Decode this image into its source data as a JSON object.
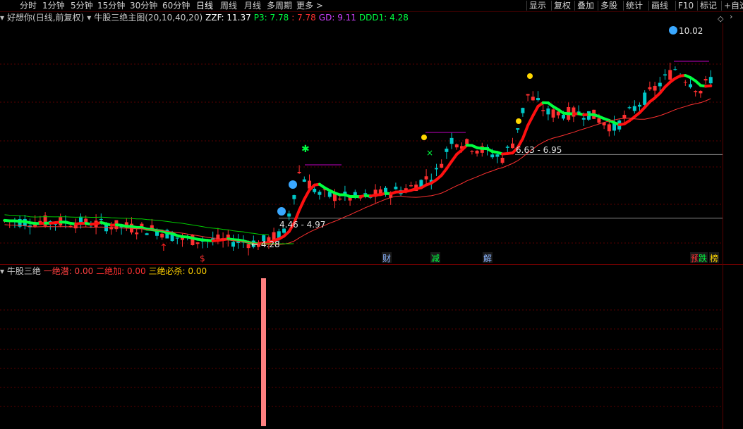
{
  "toolbar": {
    "left": [
      "分时",
      "1分钟",
      "5分钟",
      "15分钟",
      "30分钟",
      "60分钟",
      "日线",
      "周线",
      "月线",
      "多周期",
      "更多 >"
    ],
    "right": [
      "显示",
      "复权",
      "叠加",
      "多股",
      "统计",
      "画线",
      "F10",
      "标记",
      "+自选"
    ],
    "active": "日线"
  },
  "infobar": {
    "stock": "好想你(日线,前复权)",
    "indicator": "牛股三绝主图(20,10,40,20)",
    "zzf": "ZZF: 11.37",
    "p3": "P3: 7.78",
    "p3b": ": 7.78",
    "gd": "GD: 9.11",
    "ddd1": "DDD1: 4.28"
  },
  "annotations": {
    "high": "10.02",
    "range1": "4.46 - 4.97",
    "range2": "6.63 - 6.95",
    "low": "4.28",
    "markers": [
      "$",
      "财",
      "减",
      "解",
      "预",
      "跌",
      "榜"
    ]
  },
  "subbar": {
    "title": "牛股三绝",
    "v1": "一绝潜: 0.00",
    "v2": "二绝加: 0.00",
    "v3": "三绝必杀: 0.00"
  },
  "colors": {
    "up": "#ff3030",
    "down": "#00c8c8",
    "ma_green": "#00ff40",
    "ma_red": "#ff1010",
    "thin_red": "#ff3030",
    "thin_green": "#00cc00",
    "purple": "#c000c0",
    "yellow": "#ffd700",
    "pink": "#ff8080"
  }
}
